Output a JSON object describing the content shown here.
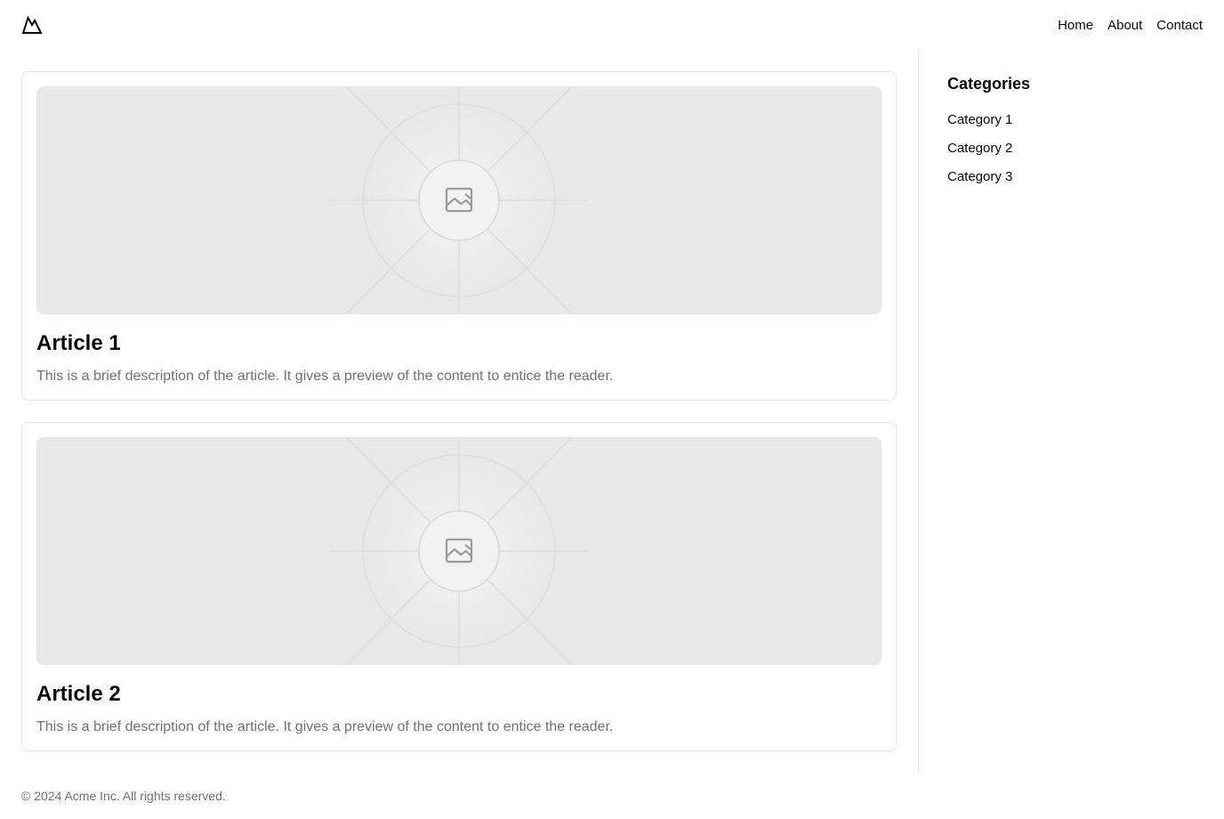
{
  "header": {
    "logo": "mountain-logo-icon",
    "nav": [
      "Home",
      "About",
      "Contact"
    ]
  },
  "articles": [
    {
      "image": "image-placeholder-icon",
      "title": "Article 1",
      "description": "This is a brief description of the article. It gives a preview of the content to entice the reader."
    },
    {
      "image": "image-placeholder-icon",
      "title": "Article 2",
      "description": "This is a brief description of the article. It gives a preview of the content to entice the reader."
    }
  ],
  "sidebar": {
    "title": "Categories",
    "items": [
      "Category 1",
      "Category 2",
      "Category 3"
    ]
  },
  "footer": {
    "text": "© 2024 Acme Inc. All rights reserved."
  },
  "colors": {
    "text": "#09090b",
    "muted": "#71717a",
    "border": "#e4e4e7",
    "placeholder": "#e8e8e8"
  }
}
